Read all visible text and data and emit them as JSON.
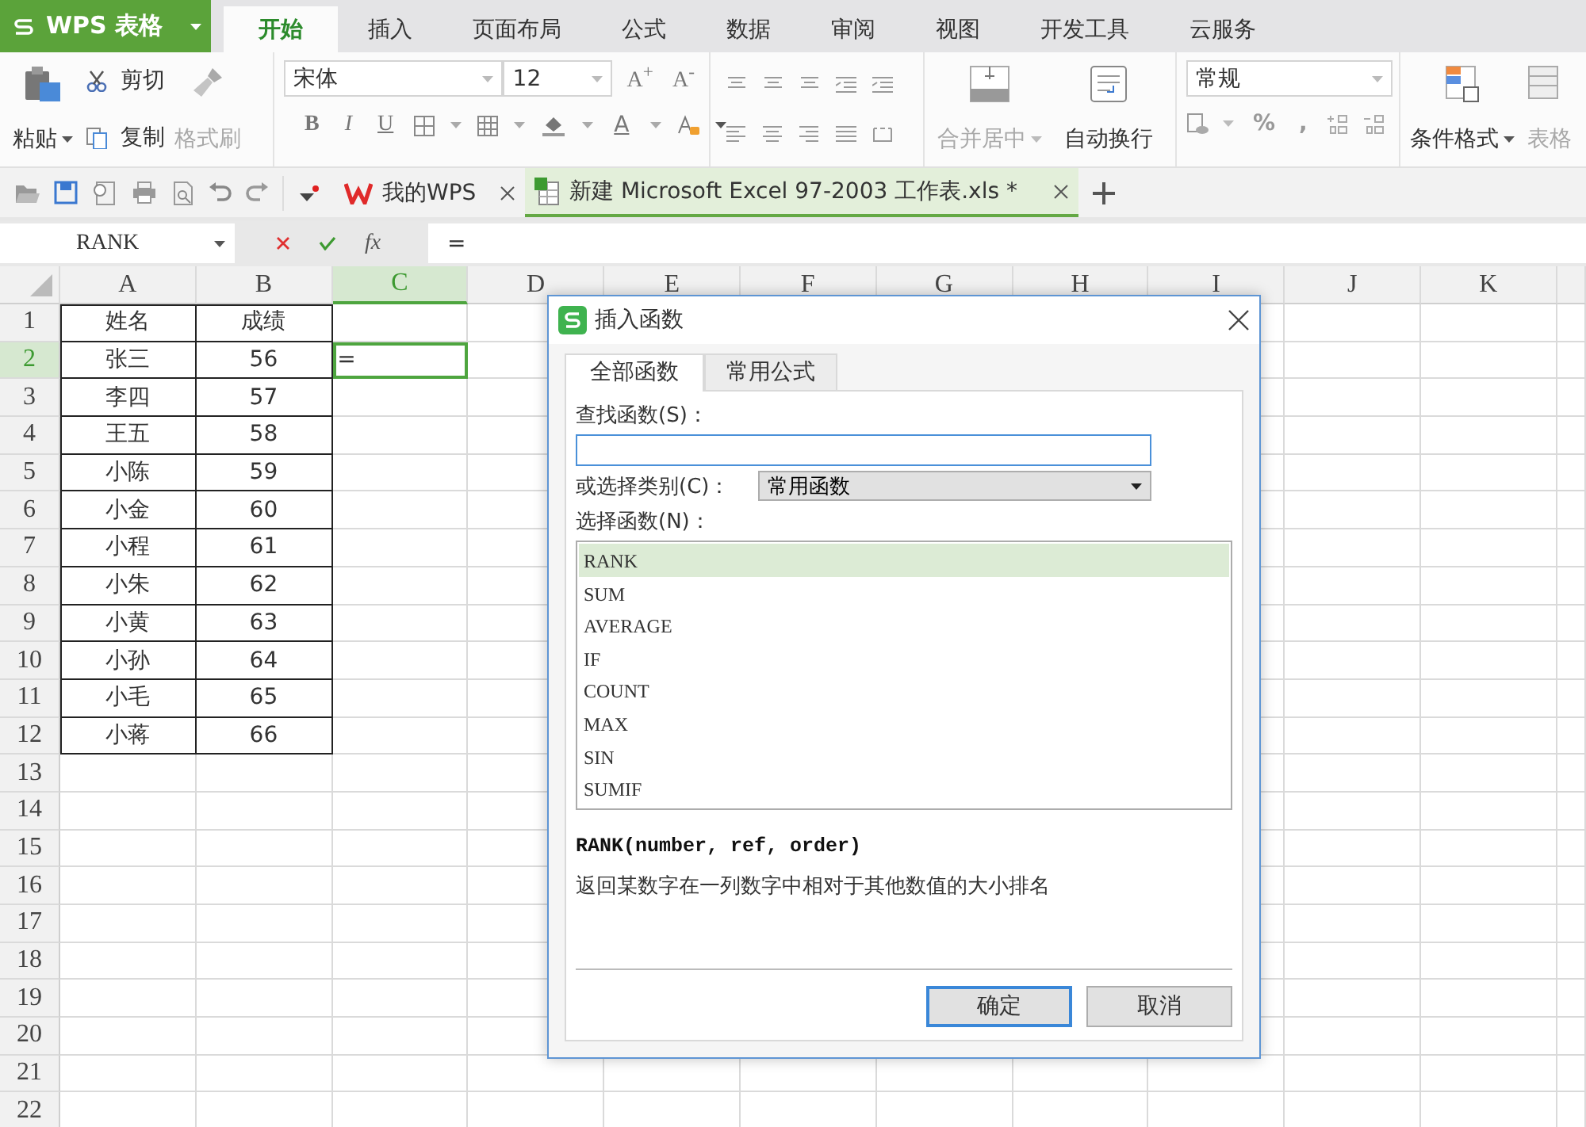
{
  "app_menu": {
    "label": "WPS 表格"
  },
  "ribbon_tabs": [
    {
      "label": "开始",
      "selected": true
    },
    {
      "label": "插入",
      "selected": false
    },
    {
      "label": "页面布局",
      "selected": false
    },
    {
      "label": "公式",
      "selected": false
    },
    {
      "label": "数据",
      "selected": false
    },
    {
      "label": "审阅",
      "selected": false
    },
    {
      "label": "视图",
      "selected": false
    },
    {
      "label": "开发工具",
      "selected": false
    },
    {
      "label": "云服务",
      "selected": false
    }
  ],
  "ribbon": {
    "paste": {
      "label": "粘贴",
      "disabled": false
    },
    "cut": {
      "label": "剪切",
      "disabled": false
    },
    "copy": {
      "label": "复制",
      "disabled": false
    },
    "format_painter": {
      "label": "格式刷",
      "disabled": true
    },
    "font_name": "宋体",
    "font_size": "12",
    "size_buttons": [
      "A$^{+}$",
      "A$^{-}$"
    ],
    "style_buttons": [
      "B",
      "I",
      "U"
    ],
    "font_color": "A",
    "merge": {
      "label": "合并居中",
      "disabled": true
    },
    "wrap": {
      "label": "自动换行",
      "disabled": false
    },
    "number_format": "常规",
    "number_buttons": [
      "%",
      ","
    ],
    "conditional_format": {
      "label": "条件格式",
      "disabled": false
    },
    "table_style": {
      "label": "表格",
      "disabled": true
    }
  },
  "doc_tabs": [
    {
      "kind": "home",
      "label": "我的WPS",
      "selected": false
    },
    {
      "kind": "sheet",
      "label": "新建 Microsoft Excel 97-2003 工作表.xls *",
      "selected": true
    }
  ],
  "formula_bar": {
    "name_box": "RANK",
    "function_button": "fx",
    "formula": "="
  },
  "sheet": {
    "columns": [
      {
        "label": "A",
        "selected": false
      },
      {
        "label": "B",
        "selected": false
      },
      {
        "label": "C",
        "selected": true
      },
      {
        "label": "D",
        "selected": false
      },
      {
        "label": "E",
        "selected": false
      },
      {
        "label": "F",
        "selected": false
      },
      {
        "label": "G",
        "selected": false
      },
      {
        "label": "H",
        "selected": false
      },
      {
        "label": "I",
        "selected": false
      },
      {
        "label": "J",
        "selected": false
      },
      {
        "label": "K",
        "selected": false
      }
    ],
    "rows": [
      {
        "label": "1",
        "selected": false,
        "cells": [
          {
            "text": "姓名",
            "bordered": true,
            "selected": false
          },
          {
            "text": "成绩",
            "bordered": true,
            "selected": false
          }
        ]
      },
      {
        "label": "2",
        "selected": true,
        "cells": [
          {
            "text": "张三",
            "bordered": true,
            "selected": false
          },
          {
            "text": "56",
            "bordered": true,
            "selected": false
          },
          {
            "text": "=",
            "bordered": false,
            "selected": true
          }
        ]
      },
      {
        "label": "3",
        "selected": false,
        "cells": [
          {
            "text": "李四",
            "bordered": true,
            "selected": false
          },
          {
            "text": "57",
            "bordered": true,
            "selected": false
          }
        ]
      },
      {
        "label": "4",
        "selected": false,
        "cells": [
          {
            "text": "王五",
            "bordered": true,
            "selected": false
          },
          {
            "text": "58",
            "bordered": true,
            "selected": false
          }
        ]
      },
      {
        "label": "5",
        "selected": false,
        "cells": [
          {
            "text": "小陈",
            "bordered": true,
            "selected": false
          },
          {
            "text": "59",
            "bordered": true,
            "selected": false
          }
        ]
      },
      {
        "label": "6",
        "selected": false,
        "cells": [
          {
            "text": "小金",
            "bordered": true,
            "selected": false
          },
          {
            "text": "60",
            "bordered": true,
            "selected": false
          }
        ]
      },
      {
        "label": "7",
        "selected": false,
        "cells": [
          {
            "text": "小程",
            "bordered": true,
            "selected": false
          },
          {
            "text": "61",
            "bordered": true,
            "selected": false
          }
        ]
      },
      {
        "label": "8",
        "selected": false,
        "cells": [
          {
            "text": "小朱",
            "bordered": true,
            "selected": false
          },
          {
            "text": "62",
            "bordered": true,
            "selected": false
          }
        ]
      },
      {
        "label": "9",
        "selected": false,
        "cells": [
          {
            "text": "小黄",
            "bordered": true,
            "selected": false
          },
          {
            "text": "63",
            "bordered": true,
            "selected": false
          }
        ]
      },
      {
        "label": "10",
        "selected": false,
        "cells": [
          {
            "text": "小孙",
            "bordered": true,
            "selected": false
          },
          {
            "text": "64",
            "bordered": true,
            "selected": false
          }
        ]
      },
      {
        "label": "11",
        "selected": false,
        "cells": [
          {
            "text": "小毛",
            "bordered": true,
            "selected": false
          },
          {
            "text": "65",
            "bordered": true,
            "selected": false
          }
        ]
      },
      {
        "label": "12",
        "selected": false,
        "cells": [
          {
            "text": "小蒋",
            "bordered": true,
            "selected": false
          },
          {
            "text": "66",
            "bordered": true,
            "selected": false
          }
        ]
      },
      {
        "label": "13",
        "selected": false
      },
      {
        "label": "14",
        "selected": false
      },
      {
        "label": "15",
        "selected": false
      },
      {
        "label": "16",
        "selected": false
      },
      {
        "label": "17",
        "selected": false
      },
      {
        "label": "18",
        "selected": false
      },
      {
        "label": "19",
        "selected": false
      },
      {
        "label": "20",
        "selected": false
      },
      {
        "label": "21",
        "selected": false
      },
      {
        "label": "22",
        "selected": false
      }
    ]
  },
  "dialog": {
    "title": "插入函数",
    "tabs": [
      {
        "label": "全部函数",
        "selected": true
      },
      {
        "label": "常用公式",
        "selected": false
      }
    ],
    "search_label": "查找函数(S)：",
    "category_label": "或选择类别(C)：",
    "category": "常用函数",
    "list_label": "选择函数(N)：",
    "functions": [
      {
        "name": "RANK",
        "selected": true
      },
      {
        "name": "SUM",
        "selected": false
      },
      {
        "name": "AVERAGE",
        "selected": false
      },
      {
        "name": "IF",
        "selected": false
      },
      {
        "name": "COUNT",
        "selected": false
      },
      {
        "name": "MAX",
        "selected": false
      },
      {
        "name": "SIN",
        "selected": false
      },
      {
        "name": "SUMIF",
        "selected": false
      }
    ],
    "signature": "RANK(number, ref, order)",
    "description": "返回某数字在一列数字中相对于其他数值的大小排名",
    "buttons": [
      {
        "label": "确定",
        "kind": "primary"
      },
      {
        "label": "取消",
        "kind": "secondary"
      }
    ]
  }
}
